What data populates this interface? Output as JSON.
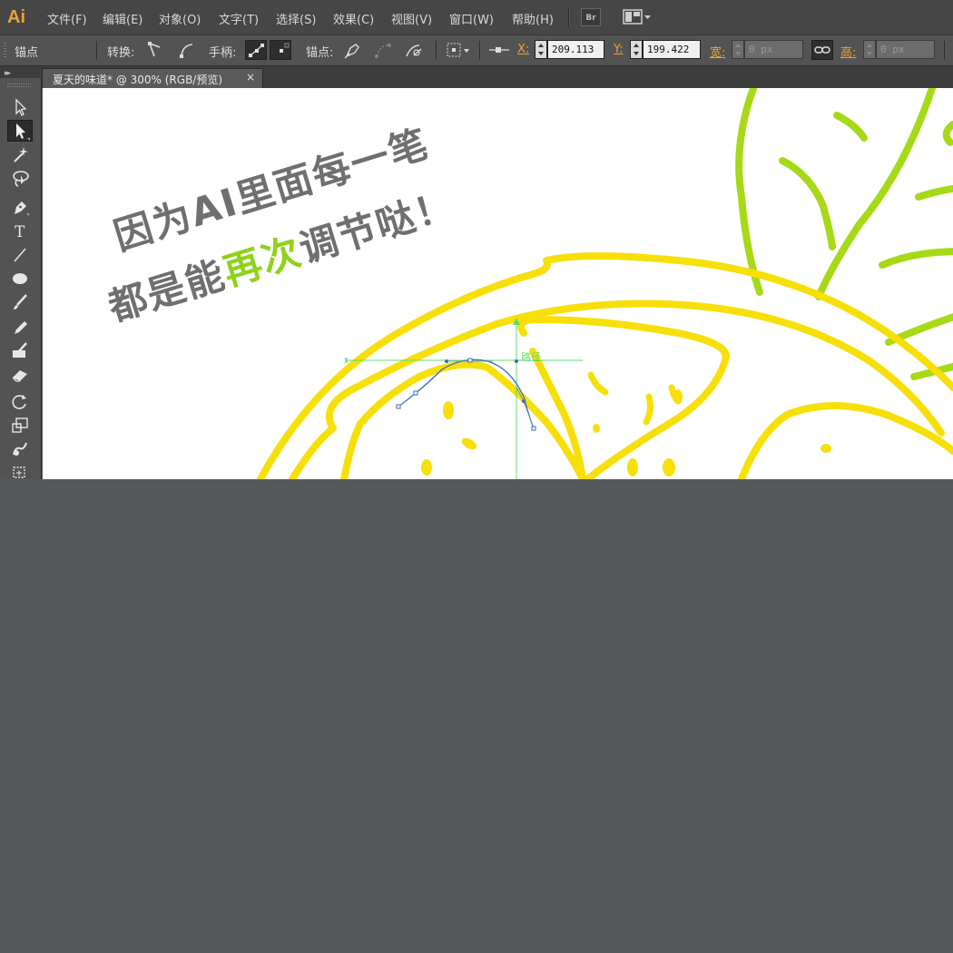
{
  "app": {
    "logo": "Ai"
  },
  "menu": {
    "items": [
      {
        "label": "文件(F)"
      },
      {
        "label": "编辑(E)"
      },
      {
        "label": "对象(O)"
      },
      {
        "label": "文字(T)"
      },
      {
        "label": "选择(S)"
      },
      {
        "label": "效果(C)"
      },
      {
        "label": "视图(V)"
      },
      {
        "label": "窗口(W)"
      },
      {
        "label": "帮助(H)"
      }
    ],
    "bridge_label": "Br"
  },
  "control_bar": {
    "selection_label": "锚点",
    "convert_label": "转换:",
    "handles_label": "手柄:",
    "anchor_label": "锚点:",
    "x_label": "X:",
    "x_value": "209.113",
    "y_label": "Y:",
    "y_value": "199.422",
    "width_label": "宽:",
    "width_value": "0 px",
    "height_label": "高:",
    "height_value": "0 px"
  },
  "tab": {
    "title": "夏天的味道* @ 300% (RGB/预览)",
    "close": "×"
  },
  "canvas": {
    "text_line1": "因为AI里面每一笔",
    "text_line2_a": "都是能",
    "text_line2_highlight": "再次",
    "text_line2_b": "调节哒！",
    "path_label": "路径",
    "colors": {
      "lemon": "#f7df0a",
      "leaf": "#a6d916",
      "highlight_text": "#8ed21a",
      "guide": "#5fdc6f",
      "path": "#3a6fb5"
    }
  },
  "tools": [
    {
      "name": "selection-tool-icon"
    },
    {
      "name": "direct-selection-tool-icon"
    },
    {
      "name": "magic-wand-tool-icon"
    },
    {
      "name": "lasso-tool-icon"
    },
    {
      "name": "pen-tool-icon"
    },
    {
      "name": "type-tool-icon",
      "glyph": "T"
    },
    {
      "name": "line-tool-icon"
    },
    {
      "name": "ellipse-tool-icon"
    },
    {
      "name": "paintbrush-tool-icon"
    },
    {
      "name": "pencil-tool-icon"
    },
    {
      "name": "blob-brush-tool-icon"
    },
    {
      "name": "eraser-tool-icon"
    },
    {
      "name": "rotate-tool-icon"
    },
    {
      "name": "scale-tool-icon"
    },
    {
      "name": "warp-tool-icon"
    },
    {
      "name": "free-transform-tool-icon"
    }
  ]
}
